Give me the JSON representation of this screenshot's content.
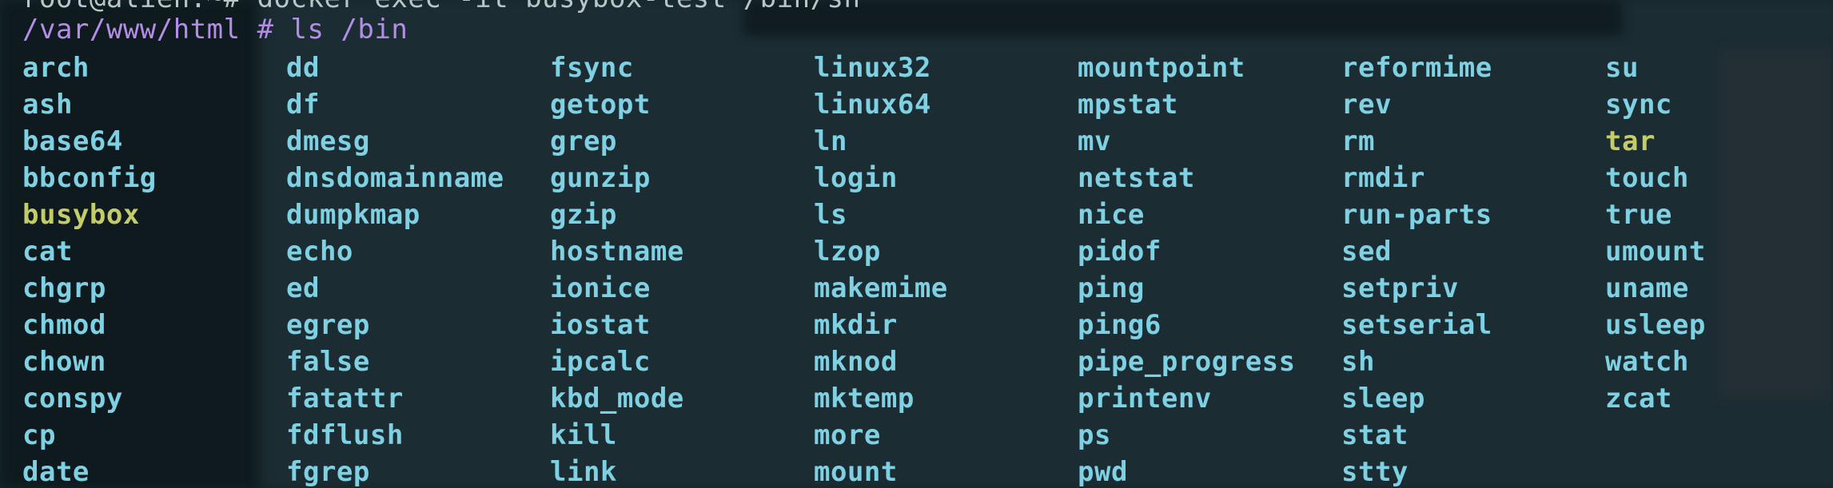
{
  "terminal": {
    "previous_line": "root@alien:~# docker exec -it busybox-test /bin/sh",
    "prompt": "/var/www/html # ls /bin",
    "colors": {
      "background": "#14262b",
      "prompt": "#b48ee6",
      "link_entry": "#7ed0e3",
      "exec_entry": "#c4cc6a"
    },
    "columns": [
      [
        {
          "name": "arch"
        },
        {
          "name": "ash"
        },
        {
          "name": "base64"
        },
        {
          "name": "bbconfig"
        },
        {
          "name": "busybox",
          "type": "executable"
        },
        {
          "name": "cat"
        },
        {
          "name": "chgrp"
        },
        {
          "name": "chmod"
        },
        {
          "name": "chown"
        },
        {
          "name": "conspy"
        },
        {
          "name": "cp"
        },
        {
          "name": "date"
        }
      ],
      [
        {
          "name": "dd"
        },
        {
          "name": "df"
        },
        {
          "name": "dmesg"
        },
        {
          "name": "dnsdomainname"
        },
        {
          "name": "dumpkmap"
        },
        {
          "name": "echo"
        },
        {
          "name": "ed"
        },
        {
          "name": "egrep"
        },
        {
          "name": "false"
        },
        {
          "name": "fatattr"
        },
        {
          "name": "fdflush"
        },
        {
          "name": "fgrep"
        }
      ],
      [
        {
          "name": "fsync"
        },
        {
          "name": "getopt"
        },
        {
          "name": "grep"
        },
        {
          "name": "gunzip"
        },
        {
          "name": "gzip"
        },
        {
          "name": "hostname"
        },
        {
          "name": "ionice"
        },
        {
          "name": "iostat"
        },
        {
          "name": "ipcalc"
        },
        {
          "name": "kbd_mode"
        },
        {
          "name": "kill"
        },
        {
          "name": "link"
        }
      ],
      [
        {
          "name": "linux32"
        },
        {
          "name": "linux64"
        },
        {
          "name": "ln"
        },
        {
          "name": "login"
        },
        {
          "name": "ls"
        },
        {
          "name": "lzop"
        },
        {
          "name": "makemime"
        },
        {
          "name": "mkdir"
        },
        {
          "name": "mknod"
        },
        {
          "name": "mktemp"
        },
        {
          "name": "more"
        },
        {
          "name": "mount"
        }
      ],
      [
        {
          "name": "mountpoint"
        },
        {
          "name": "mpstat"
        },
        {
          "name": "mv"
        },
        {
          "name": "netstat"
        },
        {
          "name": "nice"
        },
        {
          "name": "pidof"
        },
        {
          "name": "ping"
        },
        {
          "name": "ping6"
        },
        {
          "name": "pipe_progress"
        },
        {
          "name": "printenv"
        },
        {
          "name": "ps"
        },
        {
          "name": "pwd"
        }
      ],
      [
        {
          "name": "reformime"
        },
        {
          "name": "rev"
        },
        {
          "name": "rm"
        },
        {
          "name": "rmdir"
        },
        {
          "name": "run-parts"
        },
        {
          "name": "sed"
        },
        {
          "name": "setpriv"
        },
        {
          "name": "setserial"
        },
        {
          "name": "sh"
        },
        {
          "name": "sleep"
        },
        {
          "name": "stat"
        },
        {
          "name": "stty"
        }
      ],
      [
        {
          "name": "su"
        },
        {
          "name": "sync"
        },
        {
          "name": "tar",
          "type": "executable"
        },
        {
          "name": "touch"
        },
        {
          "name": "true"
        },
        {
          "name": "umount"
        },
        {
          "name": "uname"
        },
        {
          "name": "usleep"
        },
        {
          "name": "watch"
        },
        {
          "name": "zcat"
        }
      ]
    ]
  }
}
